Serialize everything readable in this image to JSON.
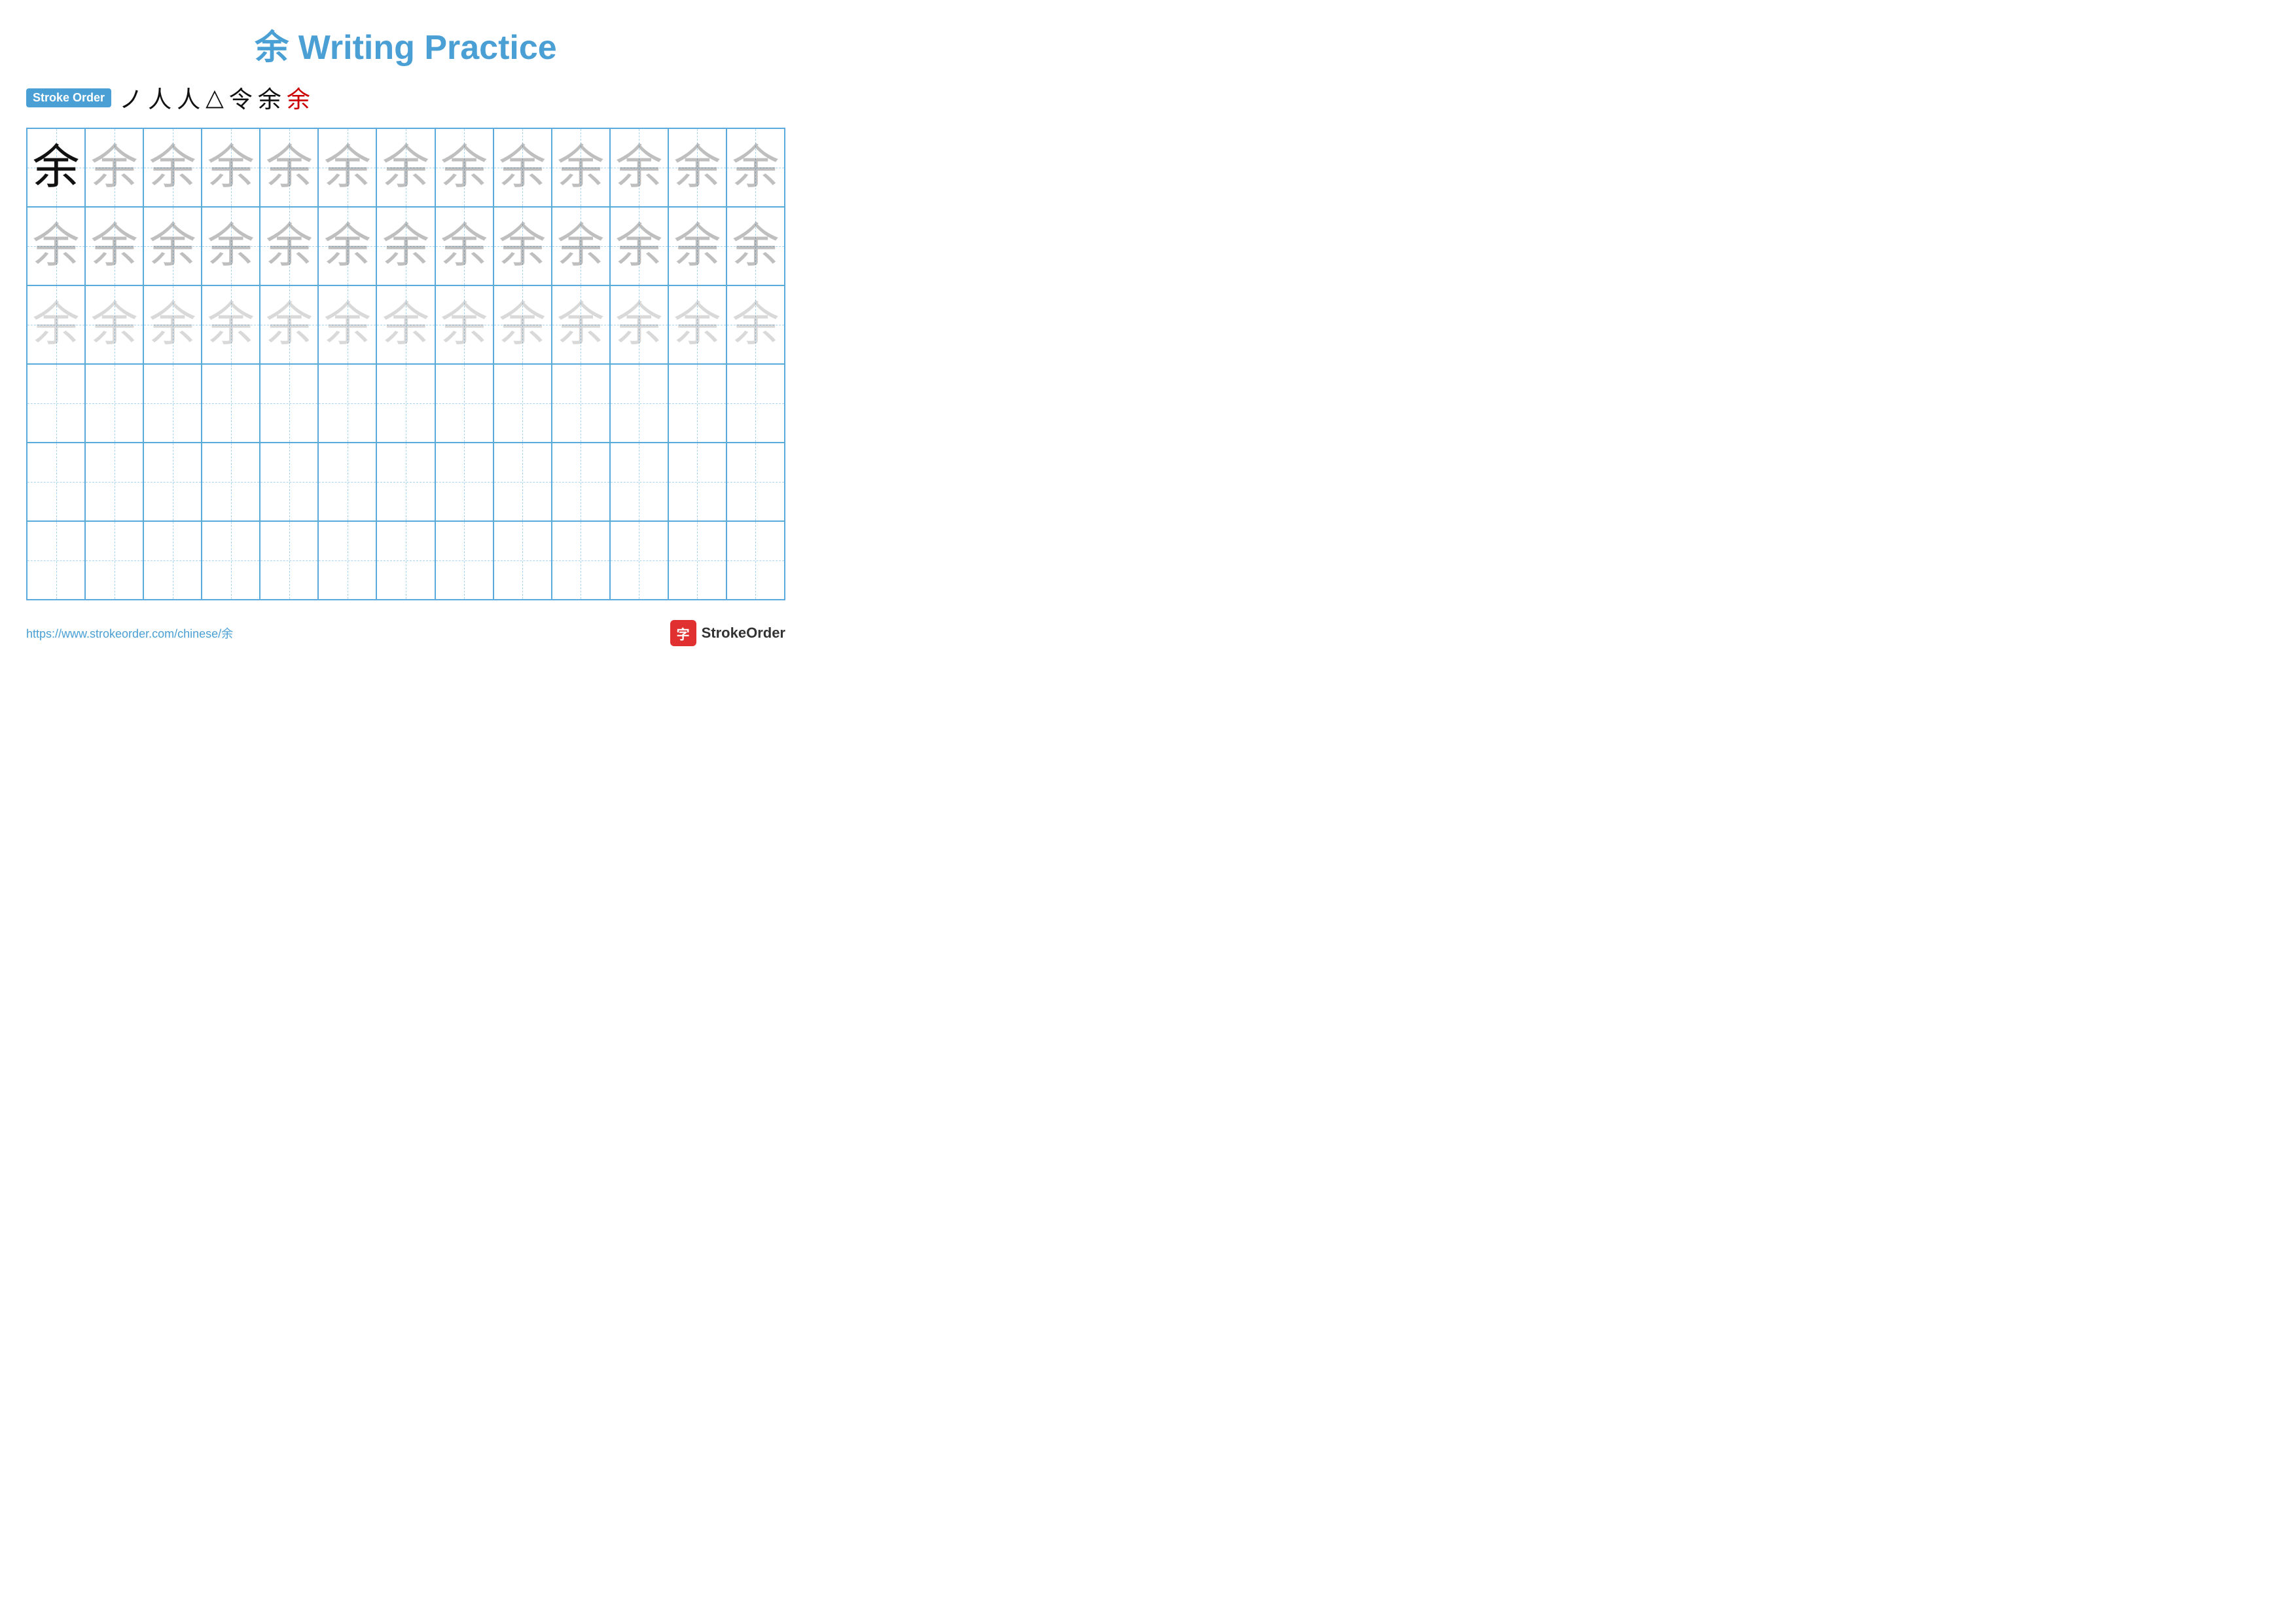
{
  "title": {
    "character": "余",
    "text": " Writing Practice",
    "full": "余 Writing Practice"
  },
  "stroke_order": {
    "badge_label": "Stroke Order",
    "strokes": [
      "ノ",
      "人",
      "人",
      "△",
      "令",
      "余",
      "余"
    ]
  },
  "grid": {
    "rows": 6,
    "cols": 13,
    "character": "余",
    "row1_style": "ghost-dark",
    "row2_style": "ghost-dark",
    "row3_style": "ghost-light",
    "rows_empty": [
      3,
      4,
      5
    ]
  },
  "footer": {
    "url": "https://www.strokeorder.com/chinese/余",
    "logo_text": "StrokeOrder",
    "logo_icon": "字"
  }
}
